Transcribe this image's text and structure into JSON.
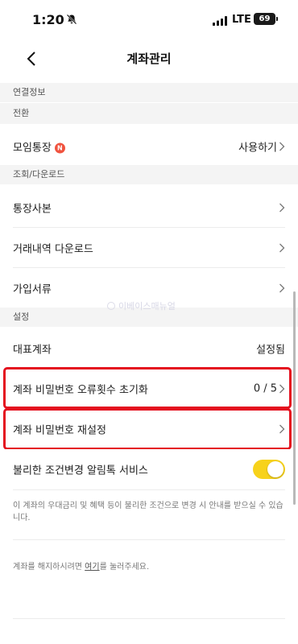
{
  "status_bar": {
    "time": "1:20",
    "network": "LTE",
    "battery": "69"
  },
  "nav": {
    "title": "계좌관리"
  },
  "sections": {
    "connection": "연결정보",
    "switch": "전환",
    "inquiry": "조회/다운로드",
    "settings": "설정"
  },
  "rows": {
    "group_account": {
      "label": "모임통장",
      "badge": "N",
      "value": "사용하기"
    },
    "passbook_copy": {
      "label": "통장사본"
    },
    "transaction_download": {
      "label": "거래내역 다운로드"
    },
    "signup_documents": {
      "label": "가입서류"
    },
    "main_account": {
      "label": "대표계좌",
      "value": "설정됨"
    },
    "pw_error_reset": {
      "label": "계좌 비밀번호 오류횟수 초기화",
      "value": "0 / 5"
    },
    "pw_reset": {
      "label": "계좌 비밀번호 재설정"
    },
    "alert_service": {
      "label": "불리한 조건변경 알림톡 서비스",
      "enabled": true
    }
  },
  "notes": {
    "alert_desc": "이 계좌의 우대금리 및 혜택 등이 불리한 조건으로 변경 시 안내를 받으실 수 있습니다.",
    "close_prefix": "계좌를 해지하시려면 ",
    "close_link": "여기",
    "close_suffix": "를 눌러주세요."
  },
  "watermark": "이베이스매뉴얼",
  "colors": {
    "toggle_on": "#f7d21b",
    "badge": "#f0533f",
    "highlight": "#e4101f",
    "section_bg": "#f4f4f4"
  }
}
